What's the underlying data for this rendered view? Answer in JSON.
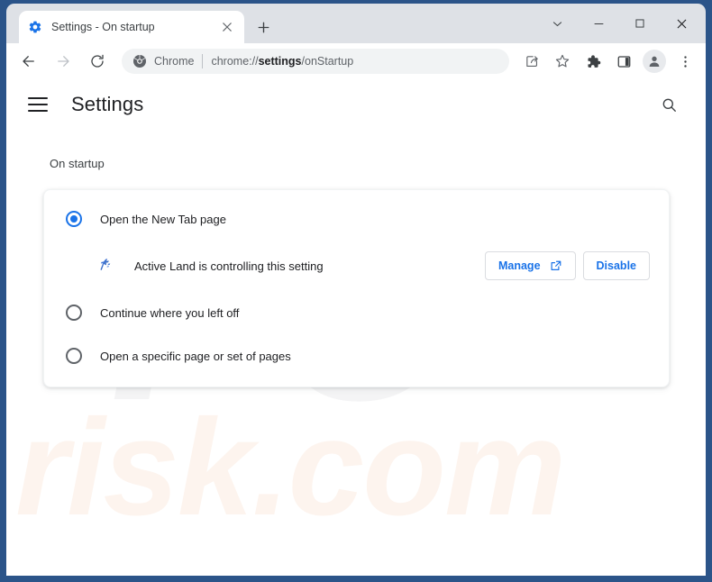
{
  "window": {
    "frame_color": "#2b5489",
    "tabstrip_color": "#dee1e6",
    "controls": [
      {
        "name": "chevron-down",
        "label": ""
      },
      {
        "name": "minimize",
        "label": ""
      },
      {
        "name": "maximize",
        "label": ""
      },
      {
        "name": "close",
        "label": ""
      }
    ]
  },
  "tab": {
    "title": "Settings - On startup",
    "favicon": "gear-icon",
    "close_label": "",
    "new_tab_label": ""
  },
  "toolbar": {
    "back": "back-arrow-icon",
    "forward": "forward-arrow-icon",
    "reload": "reload-icon",
    "omnibox": {
      "chrome_icon": "chrome-logo-icon",
      "scheme_label": "Chrome",
      "url_prefix": "chrome://",
      "url_bold": "settings",
      "url_suffix": "/onStartup"
    },
    "icons": [
      {
        "name": "share-icon"
      },
      {
        "name": "bookmark-star-icon"
      },
      {
        "name": "extensions-puzzle-icon"
      },
      {
        "name": "side-panel-icon"
      },
      {
        "name": "profile-avatar-icon"
      },
      {
        "name": "more-menu-icon"
      }
    ]
  },
  "settings": {
    "menu_label": "",
    "title": "Settings",
    "search_label": "",
    "section_label": "On startup",
    "options": [
      {
        "label": "Open the New Tab page",
        "selected": true
      },
      {
        "label": "Continue where you left off",
        "selected": false
      },
      {
        "label": "Open a specific page or set of pages",
        "selected": false
      }
    ],
    "extension_notice": {
      "icon": "extension-logo-icon",
      "text": "Active Land is controlling this setting",
      "manage_label": "Manage",
      "disable_label": "Disable"
    },
    "accent_color": "#1a73e8"
  },
  "watermark": {
    "big_text": "PC",
    "small_text": "risk.com",
    "big_color": "#f4f4f5",
    "small_color": "#fdf4ee"
  }
}
